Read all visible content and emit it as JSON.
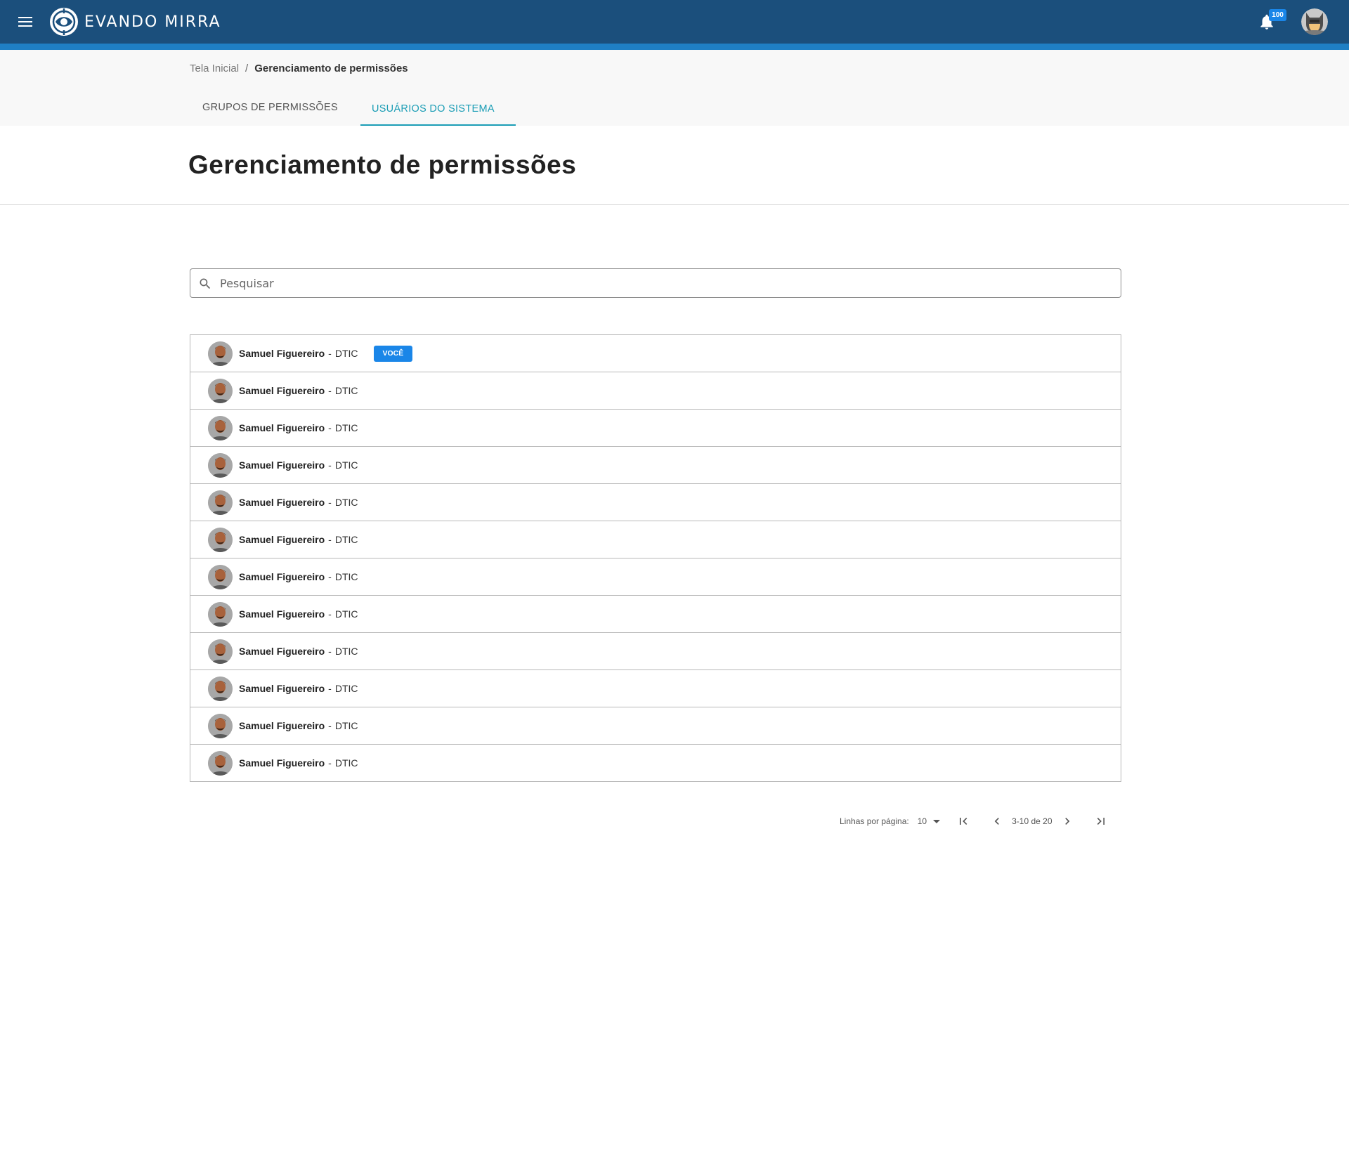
{
  "app": {
    "brand": "EVANDO MIRRA",
    "notification_count": "100"
  },
  "breadcrumb": {
    "home": "Tela Inicial",
    "separator": "/",
    "current": "Gerenciamento de permissões"
  },
  "tabs": [
    {
      "label": "GRUPOS DE PERMISSÕES",
      "active": false
    },
    {
      "label": "USUÁRIOS DO SISTEMA",
      "active": true
    }
  ],
  "page": {
    "title": "Gerenciamento de permissões"
  },
  "search": {
    "placeholder": "Pesquisar",
    "value": ""
  },
  "users": [
    {
      "name": "Samuel Figuereiro",
      "separator": "-",
      "dept": "DTIC",
      "badge": "VOCÊ"
    },
    {
      "name": "Samuel Figuereiro",
      "separator": "-",
      "dept": "DTIC"
    },
    {
      "name": "Samuel Figuereiro",
      "separator": "-",
      "dept": "DTIC"
    },
    {
      "name": "Samuel Figuereiro",
      "separator": "-",
      "dept": "DTIC"
    },
    {
      "name": "Samuel Figuereiro",
      "separator": "-",
      "dept": "DTIC"
    },
    {
      "name": "Samuel Figuereiro",
      "separator": "-",
      "dept": "DTIC"
    },
    {
      "name": "Samuel Figuereiro",
      "separator": "-",
      "dept": "DTIC"
    },
    {
      "name": "Samuel Figuereiro",
      "separator": "-",
      "dept": "DTIC"
    },
    {
      "name": "Samuel Figuereiro",
      "separator": "-",
      "dept": "DTIC"
    },
    {
      "name": "Samuel Figuereiro",
      "separator": "-",
      "dept": "DTIC"
    },
    {
      "name": "Samuel Figuereiro",
      "separator": "-",
      "dept": "DTIC"
    },
    {
      "name": "Samuel Figuereiro",
      "separator": "-",
      "dept": "DTIC"
    }
  ],
  "pagination": {
    "rows_label": "Linhas por página:",
    "rows_value": "10",
    "range": "3-10 de 20"
  },
  "icons": {
    "menu": "menu-icon",
    "logo": "logo-icon",
    "bell": "bell-icon",
    "user": "avatar",
    "search": "search-icon",
    "first_page": "first-page-icon",
    "prev_page": "chevron-left-icon",
    "next_page": "chevron-right-icon",
    "last_page": "last-page-icon"
  },
  "colors": {
    "topbar": "#1b4f7c",
    "stripe": "#1f7fc4",
    "accent": "#1a9db5",
    "badge": "#1a86e8"
  }
}
